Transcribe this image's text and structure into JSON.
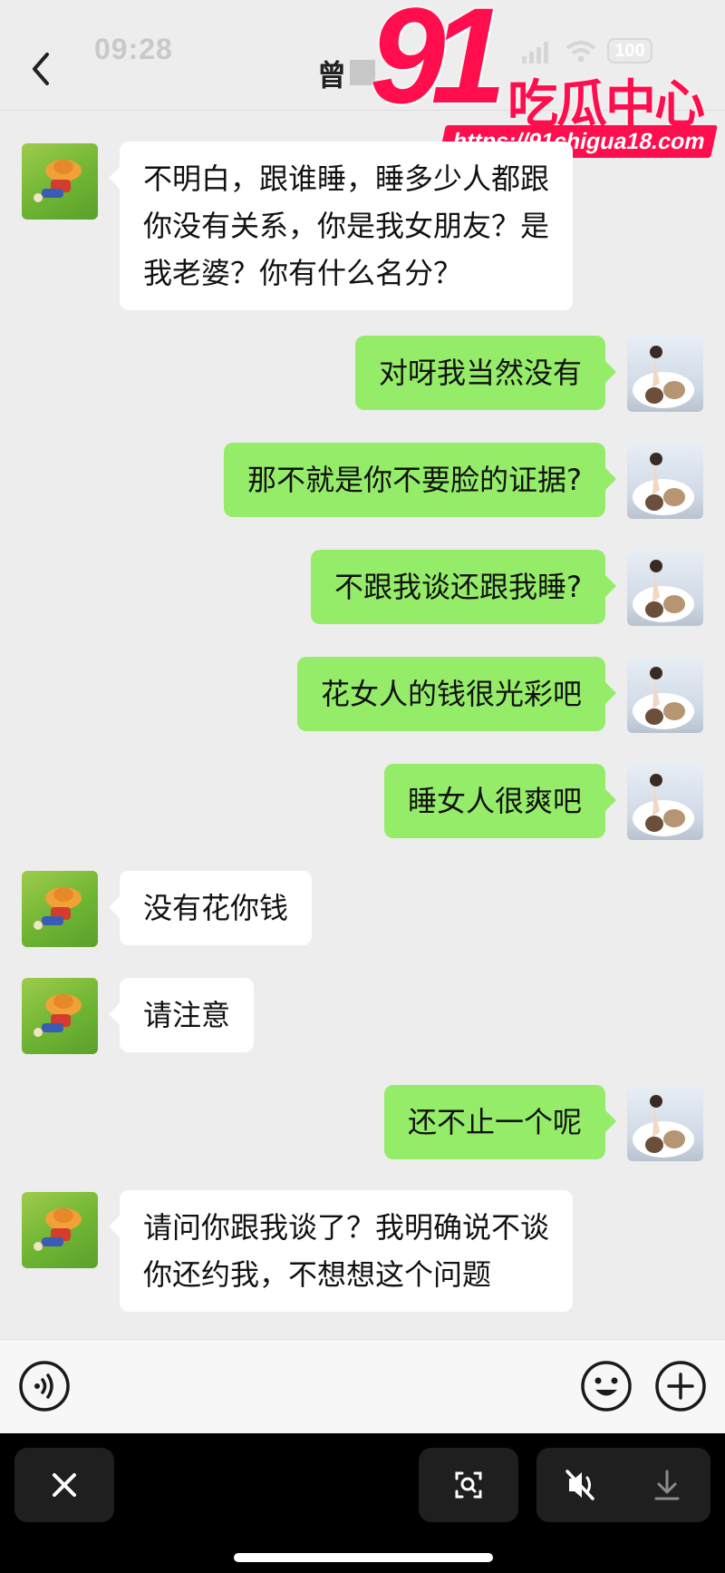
{
  "status_bar": {
    "time": "09:28",
    "battery": "100"
  },
  "header": {
    "title": "曾"
  },
  "watermark": {
    "number": "91",
    "text": "吃瓜中心",
    "url": "https://91chigua18.com"
  },
  "messages": [
    {
      "side": "left",
      "text": "不明白，跟谁睡，睡多少人都跟\n你没有关系，你是我女朋友？是\n我老婆？你有什么名分？"
    },
    {
      "side": "right",
      "text": "对呀我当然没有"
    },
    {
      "side": "right",
      "text": "那不就是你不要脸的证据?"
    },
    {
      "side": "right",
      "text": "不跟我谈还跟我睡?"
    },
    {
      "side": "right",
      "text": "花女人的钱很光彩吧"
    },
    {
      "side": "right",
      "text": "睡女人很爽吧"
    },
    {
      "side": "left",
      "text": "没有花你钱"
    },
    {
      "side": "left",
      "text": "请注意"
    },
    {
      "side": "right",
      "text": "还不止一个呢"
    },
    {
      "side": "left",
      "text": "请问你跟我谈了？我明确说不谈\n你还约我，不想想这个问题"
    }
  ],
  "icons": {
    "back": "chevron-left-icon",
    "voice": "voice-icon",
    "emoji": "emoji-icon",
    "add": "plus-icon",
    "close": "close-icon",
    "scan": "scan-icon",
    "mute": "mute-icon",
    "download": "download-icon"
  },
  "colors": {
    "outgoing_bubble": "#95ec69",
    "incoming_bubble": "#ffffff",
    "background": "#ededed",
    "watermark": "#ff0d4d"
  }
}
